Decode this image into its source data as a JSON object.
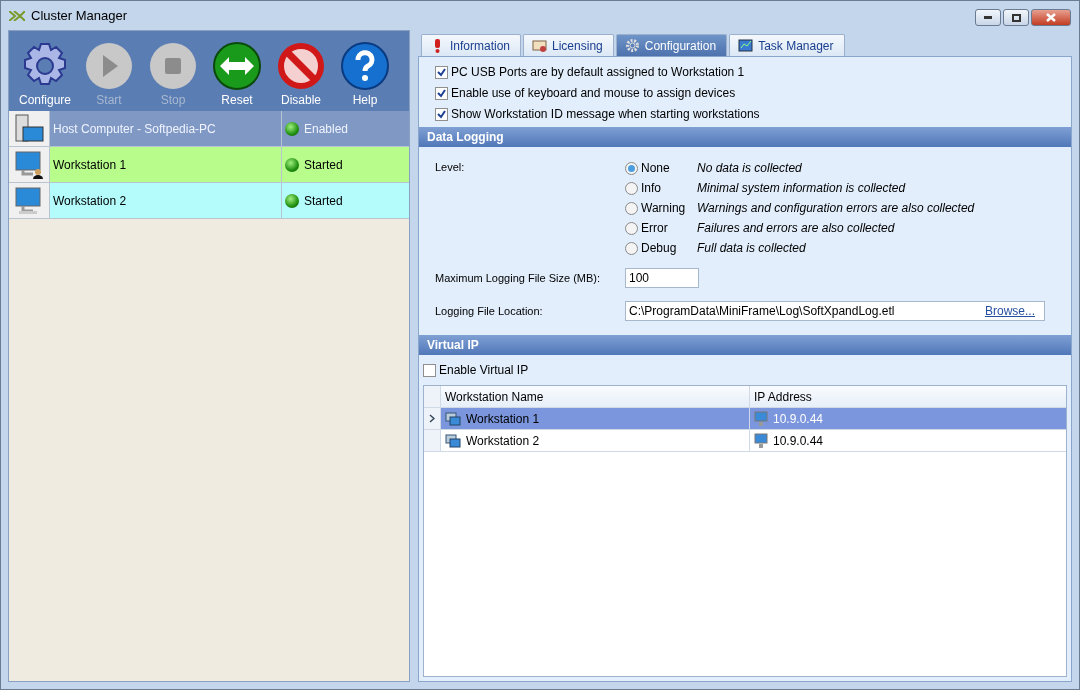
{
  "window": {
    "title": "Cluster Manager"
  },
  "toolbar": [
    {
      "label": "Configure",
      "kind": "gear",
      "disabled": false
    },
    {
      "label": "Start",
      "kind": "play",
      "disabled": true
    },
    {
      "label": "Stop",
      "kind": "stop",
      "disabled": true
    },
    {
      "label": "Reset",
      "kind": "reset",
      "disabled": false
    },
    {
      "label": "Disable",
      "kind": "disable",
      "disabled": false
    },
    {
      "label": "Help",
      "kind": "help",
      "disabled": false
    }
  ],
  "stations": [
    {
      "name": "Host Computer - Softpedia-PC",
      "kind": "host",
      "status": "Enabled",
      "color": "#8098c4"
    },
    {
      "name": "Workstation 1",
      "kind": "user",
      "status": "Started",
      "color": "#b8fc8c"
    },
    {
      "name": "Workstation 2",
      "kind": "plain",
      "status": "Started",
      "color": "#b4fcfc"
    }
  ],
  "tabs": [
    {
      "label": "Information",
      "kind": "info",
      "selected": false
    },
    {
      "label": "Licensing",
      "kind": "license",
      "selected": false
    },
    {
      "label": "Configuration",
      "kind": "gear",
      "selected": true
    },
    {
      "label": "Task Manager",
      "kind": "task",
      "selected": false
    }
  ],
  "options": [
    {
      "label": "PC USB Ports are by default assigned to Workstation 1",
      "checked": true
    },
    {
      "label": "Enable use of keyboard and mouse to assign devices",
      "checked": true
    },
    {
      "label": "Show Workstation ID message when starting workstations",
      "checked": true
    }
  ],
  "data_logging": {
    "title": "Data Logging",
    "level_label": "Level:",
    "levels": [
      {
        "label": "None",
        "description": "No data is collected",
        "selected": true
      },
      {
        "label": "Info",
        "description": "Minimal system information is collected",
        "selected": false
      },
      {
        "label": "Warning",
        "description": "Warnings and configuration errors are also collected",
        "selected": false
      },
      {
        "label": "Error",
        "description": "Failures and errors are also collected",
        "selected": false
      },
      {
        "label": "Debug",
        "description": "Full data is collected",
        "selected": false
      }
    ],
    "max_size_label": "Maximum Logging File Size (MB):",
    "max_size": "100",
    "location_label": "Logging File Location:",
    "location": "C:\\ProgramData\\MiniFrame\\Log\\SoftXpandLog.etl",
    "browse": "Browse..."
  },
  "virtual_ip": {
    "title": "Virtual IP",
    "enable": {
      "label": "Enable Virtual IP",
      "checked": false
    },
    "columns": [
      "Workstation Name",
      "IP Address"
    ],
    "rows": [
      {
        "name": "Workstation 1",
        "ip": "10.9.0.44",
        "selected": true
      },
      {
        "name": "Workstation 2",
        "ip": "10.9.0.44",
        "selected": false
      }
    ]
  }
}
